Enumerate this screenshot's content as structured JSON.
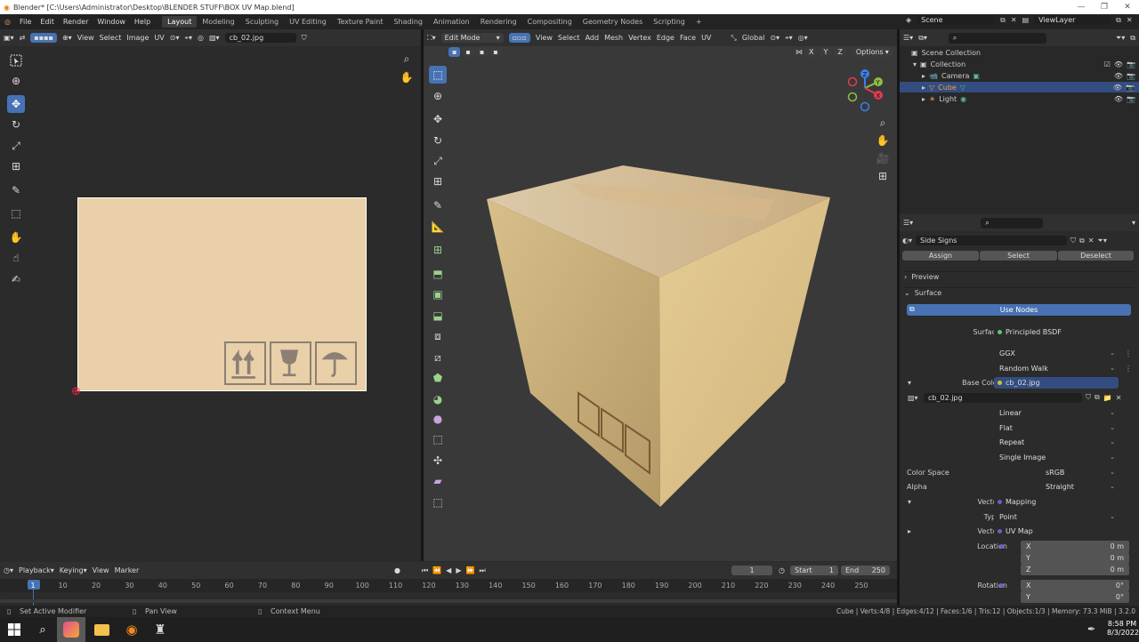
{
  "window": {
    "title": "Blender* [C:\\Users\\Administrator\\Desktop\\BLENDER STUFF\\BOX UV Map.blend]"
  },
  "menu": [
    "File",
    "Edit",
    "Render",
    "Window",
    "Help"
  ],
  "workspaces": [
    "Layout",
    "Modeling",
    "Sculpting",
    "UV Editing",
    "Texture Paint",
    "Shading",
    "Animation",
    "Rendering",
    "Compositing",
    "Geometry Nodes",
    "Scripting"
  ],
  "workspace_add": "+",
  "top_right": {
    "scene": "Scene",
    "view_layer": "ViewLayer"
  },
  "uv_editor": {
    "menus": [
      "View",
      "Select",
      "Image",
      "UV"
    ],
    "image_name": "cb_02.jpg"
  },
  "viewport": {
    "mode": "Edit Mode",
    "menus": [
      "View",
      "Select",
      "Add",
      "Mesh",
      "Vertex",
      "Edge",
      "Face",
      "UV"
    ],
    "orientation": "Global",
    "options": "Options",
    "axes": [
      "X",
      "Y",
      "Z"
    ]
  },
  "outliner": {
    "scene_collection": "Scene Collection",
    "collection": "Collection",
    "items": [
      {
        "name": "Camera"
      },
      {
        "name": "Cube"
      },
      {
        "name": "Light"
      }
    ]
  },
  "properties": {
    "material_slot": "Side Signs",
    "assign": "Assign",
    "select": "Select",
    "deselect": "Deselect",
    "preview": "Preview",
    "surface_panel": "Surface",
    "use_nodes": "Use Nodes",
    "surface_label": "Surface",
    "surface_value": "Principled BSDF",
    "distribution": "GGX",
    "subsurface": "Random Walk",
    "base_color_label": "Base Color",
    "base_color_value": "cb_02.jpg",
    "image_block": "cb_02.jpg",
    "interpolation": "Linear",
    "projection": "Flat",
    "extension": "Repeat",
    "source": "Single Image",
    "color_space_label": "Color Space",
    "color_space": "sRGB",
    "alpha_label": "Alpha",
    "alpha": "Straight",
    "vector_label": "Vector",
    "vector_value": "Mapping",
    "type_label": "Type",
    "type_value": "Point",
    "vector2_label": "Vector",
    "vector2_value": "UV Map",
    "location_label": "Location",
    "location": [
      {
        "axis": "X",
        "value": "0 m"
      },
      {
        "axis": "Y",
        "value": "0 m"
      },
      {
        "axis": "Z",
        "value": "0 m"
      }
    ],
    "rotation_label": "Rotation",
    "rotation": [
      {
        "axis": "X",
        "value": "0°"
      },
      {
        "axis": "Y",
        "value": "0°"
      }
    ]
  },
  "timeline": {
    "menus": [
      "Playback",
      "Keying",
      "View",
      "Marker"
    ],
    "current_frame": "1",
    "start_label": "Start",
    "start": "1",
    "end_label": "End",
    "end": "250",
    "ticks": [
      "1",
      "10",
      "20",
      "30",
      "40",
      "50",
      "60",
      "70",
      "80",
      "90",
      "100",
      "110",
      "120",
      "130",
      "140",
      "150",
      "160",
      "170",
      "180",
      "190",
      "200",
      "210",
      "220",
      "230",
      "240",
      "250"
    ]
  },
  "statusbar": {
    "left1": "Set Active Modifier",
    "left2": "Pan View",
    "left3": "Context Menu",
    "right": "Cube | Verts:4/8 | Edges:4/12 | Faces:1/6 | Tris:12 | Objects:1/3 | Memory: 73.3 MiB | 3.2.0"
  },
  "taskbar": {
    "time": "8:58 PM",
    "date": "8/3/2022"
  },
  "colors": {
    "accent": "#4772b3",
    "cardboard": "#e8cfa8",
    "panel": "#303030",
    "viewport_bg": "#393939"
  }
}
